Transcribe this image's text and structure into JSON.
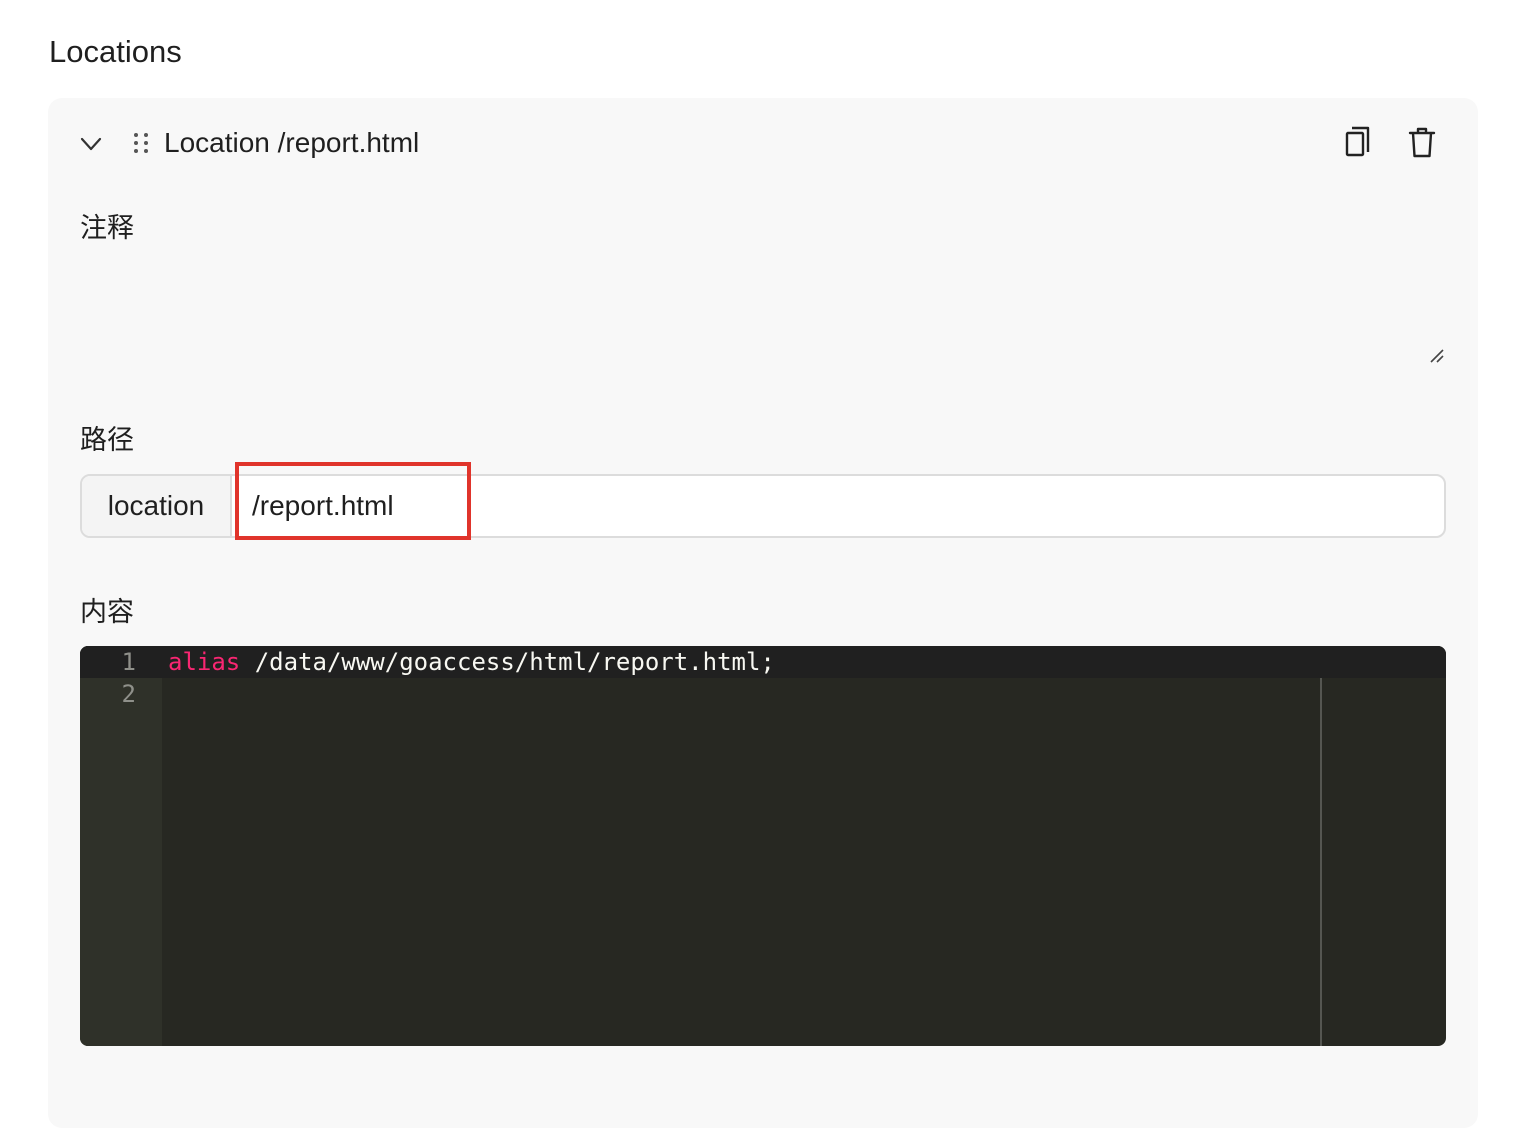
{
  "section": {
    "title": "Locations"
  },
  "location_card": {
    "title": "Location /report.html",
    "comment": {
      "label": "注释",
      "value": ""
    },
    "path": {
      "label": "路径",
      "prefix": "location",
      "value": "/report.html"
    },
    "content": {
      "label": "内容",
      "lines": [
        {
          "number": "1",
          "keyword": "alias",
          "text": " /data/www/goaccess/html/report.html;"
        },
        {
          "number": "2",
          "keyword": "",
          "text": ""
        }
      ]
    }
  },
  "colors": {
    "card_bg": "#f8f8f8",
    "highlight": "#e0342b",
    "editor_bg": "#272822",
    "keyword": "#f92672"
  },
  "icons": [
    "chevron-down-icon",
    "drag-handle-icon",
    "copy-icon",
    "trash-icon",
    "resize-grip-icon"
  ]
}
